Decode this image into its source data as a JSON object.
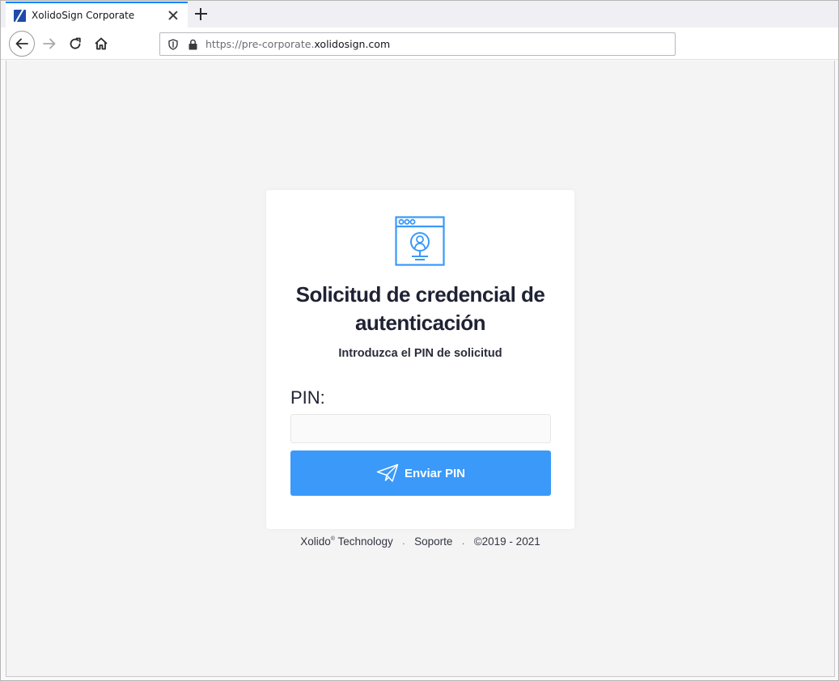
{
  "browser": {
    "tab_title": "XolidoSign Corporate",
    "url_prefix": "https://pre-corporate.",
    "url_domain": "xolidosign.com",
    "accent_color": "#0a84ff"
  },
  "card": {
    "title": "Solicitud de credencial de autenticación",
    "subtitle": "Introduzca el PIN de solicitud",
    "pin_label": "PIN:",
    "pin_value": "",
    "pin_placeholder": "",
    "submit_label": "Enviar PIN",
    "icon": "browser-user-icon",
    "button_color": "#3a99f9"
  },
  "footer": {
    "company": "Xolido",
    "registered": "®",
    "company_suffix": " Technology",
    "support_link": "Soporte",
    "copyright": "©2019 - 2021",
    "separator": "."
  }
}
